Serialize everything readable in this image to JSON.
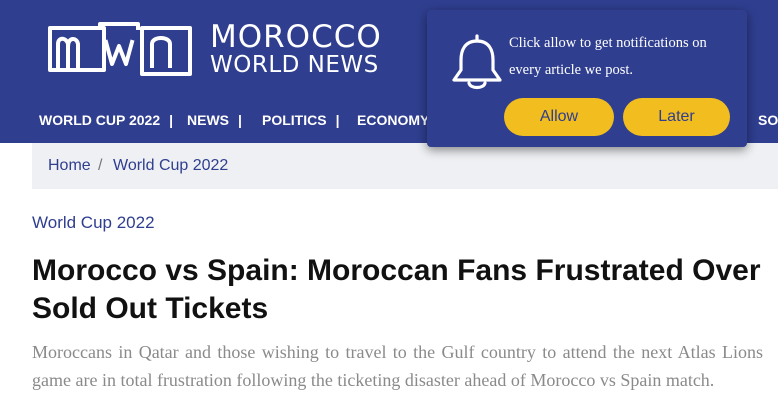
{
  "logo": {
    "mark": "mwn",
    "line1": "MOROCCO",
    "line2": "WORLD NEWS"
  },
  "nav": {
    "items": [
      {
        "label": "WORLD CUP 2022",
        "sep": "|"
      },
      {
        "label": "NEWS",
        "sep": "|"
      },
      {
        "label": "POLITICS",
        "sep": "|"
      },
      {
        "label": "ECONOMY",
        "sep": ""
      },
      {
        "label": "SO",
        "sep": ""
      }
    ]
  },
  "popup": {
    "message": "Click allow to get notifications on every article we post.",
    "allow_label": "Allow",
    "later_label": "Later",
    "icon": "bell-icon"
  },
  "breadcrumb": {
    "home": "Home",
    "separator": "/",
    "current": "World Cup 2022"
  },
  "article": {
    "category": "World Cup 2022",
    "title": "Morocco vs Spain: Moroccan Fans Frustrated Over Sold Out Tickets",
    "excerpt": "Moroccans in Qatar and those wishing to travel to the Gulf country to attend the next Atlas Lions game are in total frustration following the ticketing disaster ahead of Morocco vs Spain match."
  },
  "colors": {
    "brand_blue": "#2f3e8f",
    "button_yellow": "#f2bd1e",
    "breadcrumb_bg": "#eef0f3",
    "excerpt_gray": "#8a8a8a"
  }
}
